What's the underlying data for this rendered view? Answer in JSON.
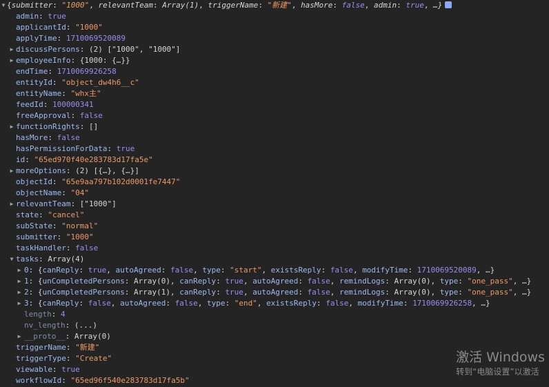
{
  "root": {
    "summary_parts": [
      {
        "k": "submitter",
        "v": "\"1000\"",
        "t": "str"
      },
      {
        "k": "relevantTeam",
        "v": "Array(1)",
        "t": "plain"
      },
      {
        "k": "triggerName",
        "v": "\"新建\"",
        "t": "str"
      },
      {
        "k": "hasMore",
        "v": "false",
        "t": "bool"
      },
      {
        "k": "admin",
        "v": "true",
        "t": "bool"
      }
    ],
    "summary_tail": "…}"
  },
  "props": [
    {
      "key": "admin",
      "value": "true",
      "type": "bool"
    },
    {
      "key": "applicantId",
      "value": "\"1000\"",
      "type": "str"
    },
    {
      "key": "applyTime",
      "value": "1710069520089",
      "type": "num"
    },
    {
      "key": "discussPersons",
      "prefix": "(2) ",
      "value": "[\"1000\", \"1000\"]",
      "type": "plain",
      "expandable": true
    },
    {
      "key": "employeeInfo",
      "value": "{1000: {…}}",
      "type": "plain",
      "expandable": true
    },
    {
      "key": "endTime",
      "value": "1710069926258",
      "type": "num"
    },
    {
      "key": "entityId",
      "value": "\"object_dw4h6__c\"",
      "type": "str"
    },
    {
      "key": "entityName",
      "value": "\"whx主\"",
      "type": "str"
    },
    {
      "key": "feedId",
      "value": "100000341",
      "type": "num"
    },
    {
      "key": "freeApproval",
      "value": "false",
      "type": "bool"
    },
    {
      "key": "functionRights",
      "value": "[]",
      "type": "plain",
      "expandable": true
    },
    {
      "key": "hasMore",
      "value": "false",
      "type": "bool"
    },
    {
      "key": "hasPermissionForData",
      "value": "true",
      "type": "bool"
    },
    {
      "key": "id",
      "value": "\"65ed970f40e283783d17fa5e\"",
      "type": "str"
    },
    {
      "key": "moreOptions",
      "prefix": "(2) ",
      "value": "[{…}, {…}]",
      "type": "plain",
      "expandable": true
    },
    {
      "key": "objectId",
      "value": "\"65e9aa797b102d0001fe7447\"",
      "type": "str"
    },
    {
      "key": "objectName",
      "value": "\"04\"",
      "type": "str"
    },
    {
      "key": "relevantTeam",
      "value": "[\"1000\"]",
      "type": "plain",
      "expandable": true
    }
  ],
  "props2": [
    {
      "key": "state",
      "value": "\"cancel\"",
      "type": "str"
    },
    {
      "key": "subState",
      "value": "\"normal\"",
      "type": "str"
    },
    {
      "key": "submitter",
      "value": "\"1000\"",
      "type": "str"
    },
    {
      "key": "taskHandler",
      "value": "false",
      "type": "bool"
    }
  ],
  "tasks": {
    "key": "tasks",
    "value": "Array(4)",
    "items": [
      {
        "idx": "0",
        "parts": [
          {
            "k": "canReply",
            "v": "true",
            "t": "bool"
          },
          {
            "k": "autoAgreed",
            "v": "false",
            "t": "bool"
          },
          {
            "k": "type",
            "v": "\"start\"",
            "t": "str"
          },
          {
            "k": "existsReply",
            "v": "false",
            "t": "bool"
          },
          {
            "k": "modifyTime",
            "v": "1710069520089",
            "t": "num"
          }
        ]
      },
      {
        "idx": "1",
        "parts": [
          {
            "k": "unCompletedPersons",
            "v": "Array(0)",
            "t": "plain"
          },
          {
            "k": "canReply",
            "v": "true",
            "t": "bool"
          },
          {
            "k": "autoAgreed",
            "v": "false",
            "t": "bool"
          },
          {
            "k": "remindLogs",
            "v": "Array(0)",
            "t": "plain"
          },
          {
            "k": "type",
            "v": "\"one_pass\"",
            "t": "str"
          }
        ]
      },
      {
        "idx": "2",
        "parts": [
          {
            "k": "unCompletedPersons",
            "v": "Array(1)",
            "t": "plain"
          },
          {
            "k": "canReply",
            "v": "true",
            "t": "bool"
          },
          {
            "k": "autoAgreed",
            "v": "false",
            "t": "bool"
          },
          {
            "k": "remindLogs",
            "v": "Array(0)",
            "t": "plain"
          },
          {
            "k": "type",
            "v": "\"one_pass\"",
            "t": "str"
          }
        ]
      },
      {
        "idx": "3",
        "parts": [
          {
            "k": "canReply",
            "v": "false",
            "t": "bool"
          },
          {
            "k": "autoAgreed",
            "v": "false",
            "t": "bool"
          },
          {
            "k": "type",
            "v": "\"end\"",
            "t": "str"
          },
          {
            "k": "existsReply",
            "v": "false",
            "t": "bool"
          },
          {
            "k": "modifyTime",
            "v": "1710069926258",
            "t": "num"
          }
        ]
      }
    ],
    "length_key": "length",
    "length_value": "4",
    "nv_key": "nv_length",
    "nv_value": "(...)",
    "proto_key": "__proto__",
    "proto_value": "Array(0)"
  },
  "props3": [
    {
      "key": "triggerName",
      "value": "\"新建\"",
      "type": "str"
    },
    {
      "key": "triggerType",
      "value": "\"Create\"",
      "type": "str"
    },
    {
      "key": "viewable",
      "value": "true",
      "type": "bool"
    },
    {
      "key": "workflowId",
      "value": "\"65ed96f540e283783d17fa5b\"",
      "type": "str"
    }
  ],
  "watermark": {
    "title": "激活 Windows",
    "subtitle": "转到“电脑设置”以激活"
  }
}
